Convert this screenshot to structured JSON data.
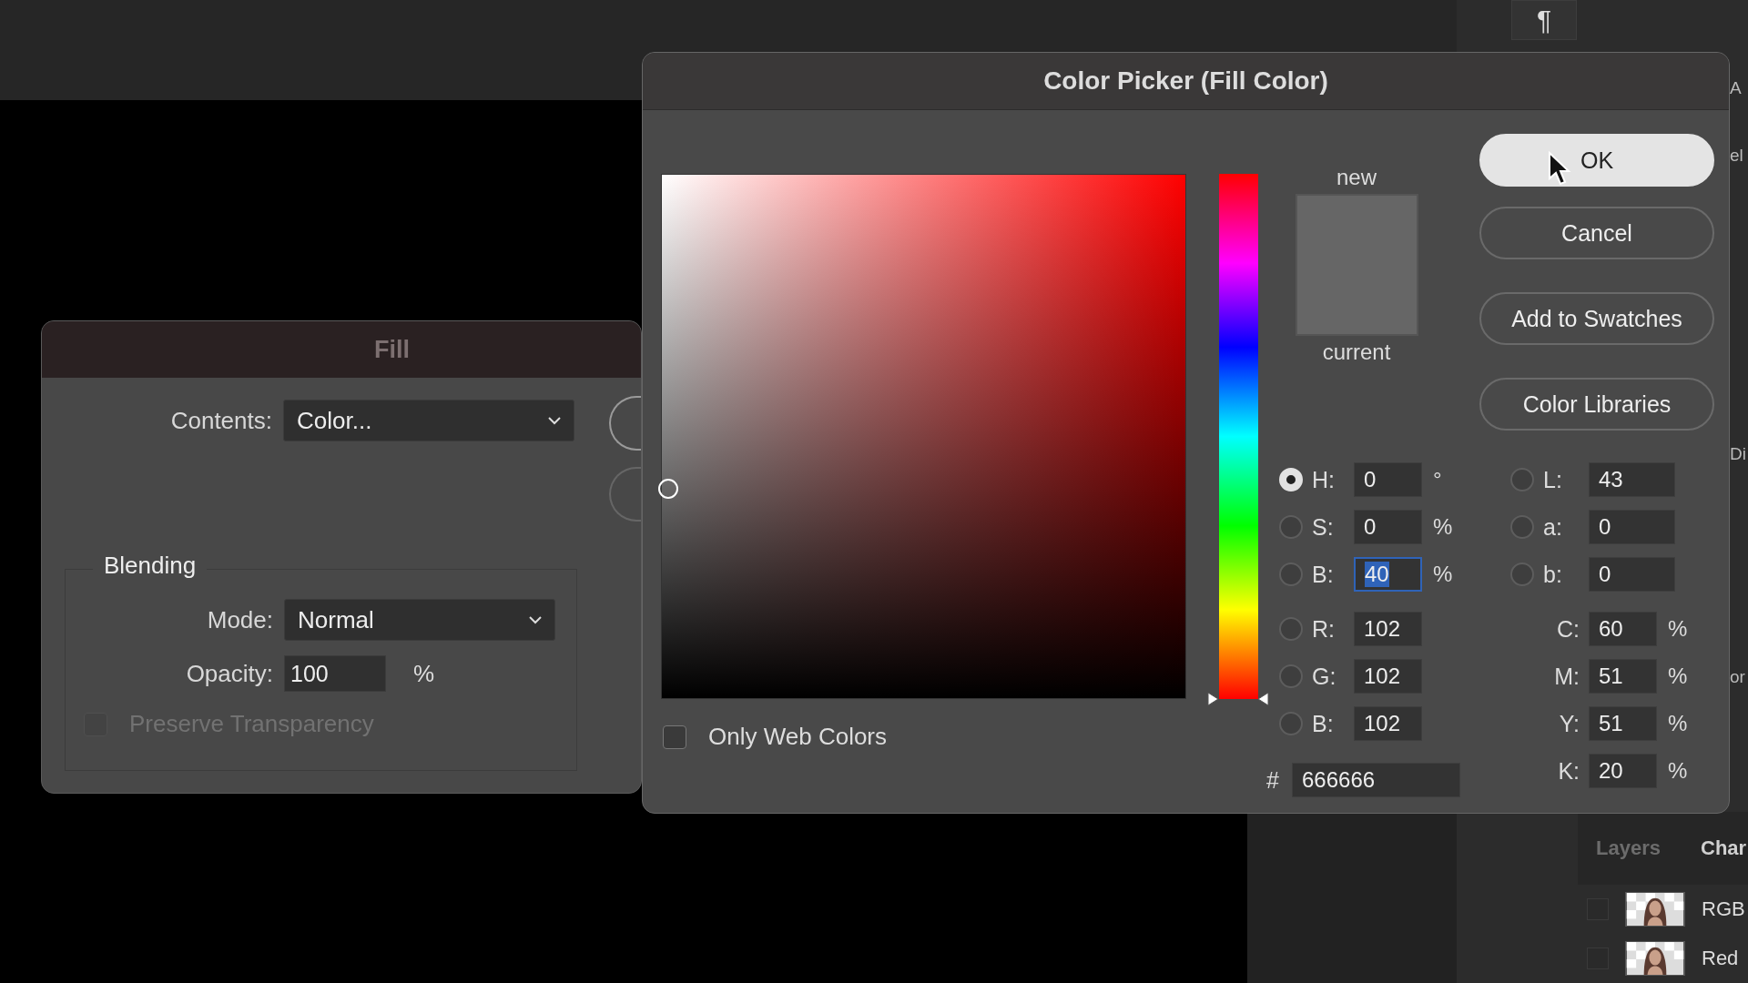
{
  "fill_dialog": {
    "title": "Fill",
    "contents": {
      "label": "Contents:",
      "value": "Color..."
    },
    "blending": {
      "legend": "Blending",
      "mode": {
        "label": "Mode:",
        "value": "Normal"
      },
      "opacity": {
        "label": "Opacity:",
        "value": "100",
        "unit": "%"
      },
      "preserve_transparency": {
        "label": "Preserve Transparency",
        "checked": false,
        "disabled": true
      }
    },
    "side_buttons": [
      {
        "kind": "outline"
      },
      {
        "kind": "outline"
      }
    ]
  },
  "color_picker": {
    "title": "Color Picker (Fill Color)",
    "color_field": {
      "saturation": {
        "level": 0
      }
    },
    "hue_slider": {
      "level": 0
    },
    "new": {
      "label": "new",
      "color": "#666666"
    },
    "current": {
      "label": "current",
      "color": "#666666"
    },
    "buttons": [
      {
        "label": "OK",
        "default": true
      },
      {
        "label": "Cancel",
        "default": false
      },
      {
        "label": "Add to Swatches",
        "default": false
      },
      {
        "label": "Color Libraries",
        "default": false
      }
    ],
    "fields_left": [
      {
        "kind": "radio",
        "label": "H:",
        "value": "0",
        "unit": "°",
        "selected": true,
        "highlighted": false
      },
      {
        "kind": "radio",
        "label": "S:",
        "value": "0",
        "unit": "%",
        "selected": false,
        "highlighted": false
      },
      {
        "kind": "radio",
        "label": "B:",
        "value": "40",
        "unit": "%",
        "selected": false,
        "highlighted": true
      },
      {
        "kind": "radio",
        "label": "R:",
        "value": "102",
        "selected": false,
        "highlighted": false
      },
      {
        "kind": "radio",
        "label": "G:",
        "value": "102",
        "selected": false,
        "highlighted": false
      },
      {
        "kind": "radio",
        "label": "B:",
        "value": "102",
        "selected": false,
        "highlighted": false
      }
    ],
    "hex": {
      "label": "#",
      "value": "666666"
    },
    "fields_right": [
      {
        "kind": "radio",
        "label": "L:",
        "value": "43",
        "selected": false
      },
      {
        "kind": "radio",
        "label": "a:",
        "value": "0",
        "selected": false
      },
      {
        "kind": "radio",
        "label": "b:",
        "value": "0",
        "selected": false
      },
      {
        "kind": "plain",
        "label": "C:",
        "value": "60",
        "unit": "%"
      },
      {
        "kind": "plain",
        "label": "M:",
        "value": "51",
        "unit": "%"
      },
      {
        "kind": "plain",
        "label": "Y:",
        "value": "51",
        "unit": "%"
      },
      {
        "kind": "plain",
        "label": "K:",
        "value": "20",
        "unit": "%"
      }
    ],
    "web_colors": {
      "label": "Only Web Colors",
      "checked": false
    }
  },
  "side_panel": {
    "top_icon": "¶",
    "edge_text": [
      "A",
      "el",
      "Di",
      "or"
    ],
    "tabs": [
      {
        "label": "Layers",
        "selected": false
      },
      {
        "label": "Char",
        "selected": true
      }
    ],
    "channels": [
      {
        "name": "RGB",
        "visible": false
      },
      {
        "name": "Red",
        "visible": false
      }
    ]
  }
}
